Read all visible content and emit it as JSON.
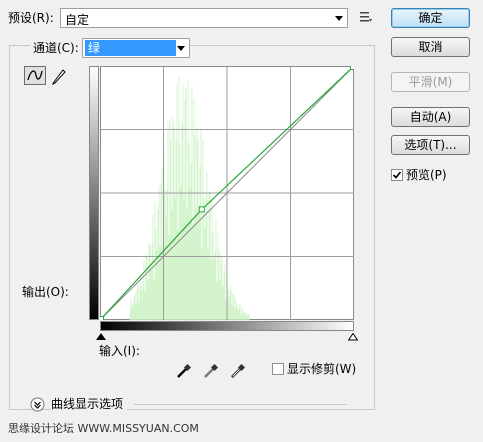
{
  "preset": {
    "label": "预设(R):",
    "value": "自定"
  },
  "channel": {
    "label": "通道(C):",
    "value": "绿"
  },
  "buttons": {
    "ok": "确定",
    "cancel": "取消",
    "smooth": "平滑(M)",
    "auto": "自动(A)",
    "options": "选项(T)..."
  },
  "preview": {
    "label": "预览(P)",
    "checked": true
  },
  "output_label": "输出(O):",
  "input_label": "输入(I):",
  "show_clipping": {
    "label": "显示修剪(W)",
    "checked": false
  },
  "curve_display_options": "曲线显示选项",
  "watermark": "思缘设计论坛 WWW.MISSYUAN.COM",
  "colors": {
    "accent": "#3399ff",
    "curve": "#27a83a",
    "histogram": "#c8f2c0"
  },
  "icons": [
    "curve-tool-icon",
    "pencil-icon",
    "preset-menu-icon",
    "black-eyedropper-icon",
    "gray-eyedropper-icon",
    "white-eyedropper-icon",
    "expand-chevron-icon"
  ],
  "curve": {
    "points": [
      [
        0,
        0
      ],
      [
        0.4,
        0.435
      ],
      [
        1,
        1
      ]
    ]
  }
}
